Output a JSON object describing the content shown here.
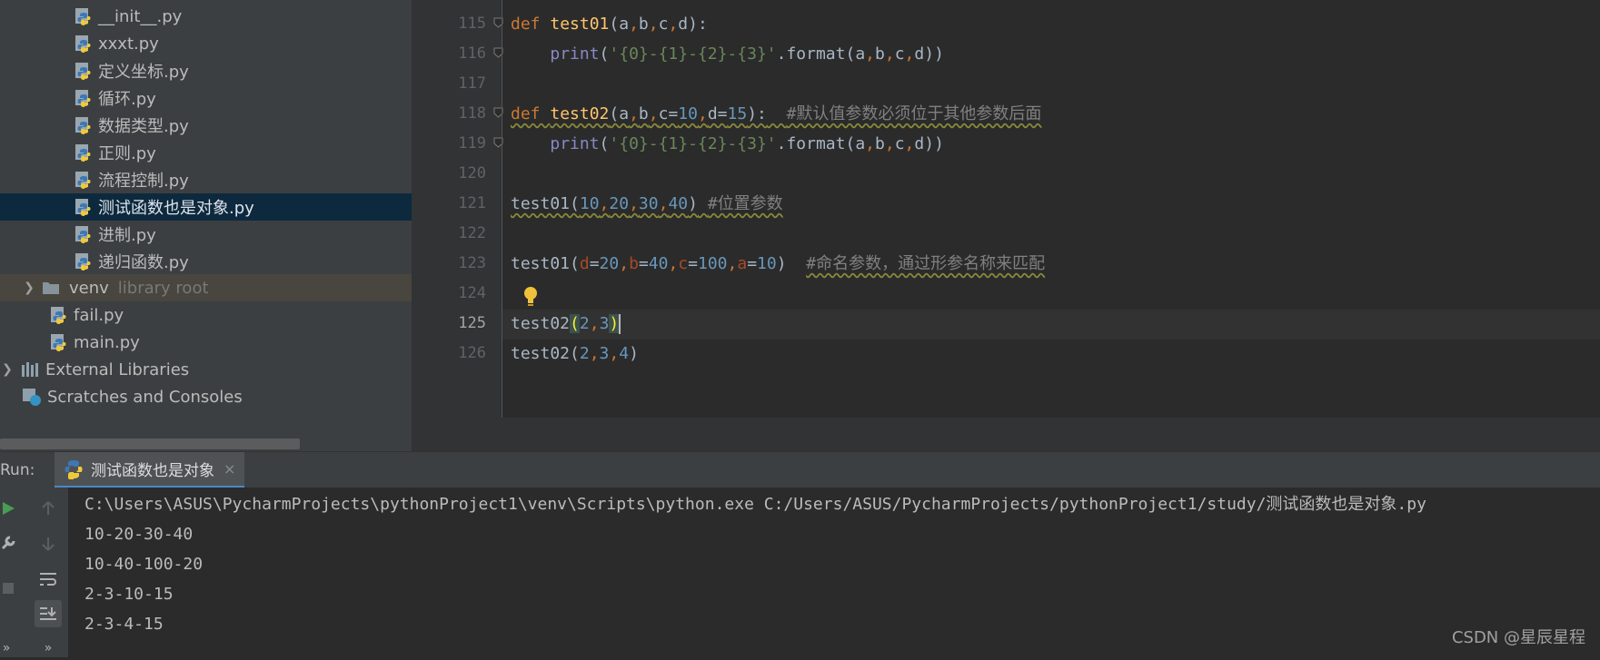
{
  "project_tree": {
    "files": [
      {
        "label": "__init__.py"
      },
      {
        "label": "xxxt.py"
      },
      {
        "label": "定义坐标.py"
      },
      {
        "label": "循环.py"
      },
      {
        "label": "数据类型.py"
      },
      {
        "label": "正则.py"
      },
      {
        "label": "流程控制.py"
      },
      {
        "label": "测试函数也是对象.py",
        "selected": true
      },
      {
        "label": "进制.py"
      },
      {
        "label": "递归函数.py"
      }
    ],
    "venv": {
      "label": "venv",
      "hint": "library root"
    },
    "root_files": [
      {
        "label": "fail.py"
      },
      {
        "label": "main.py"
      }
    ],
    "external_libraries": "External Libraries",
    "scratches": "Scratches and Consoles"
  },
  "editor": {
    "current_line": "125",
    "lines": [
      {
        "num": "115",
        "tokens": [
          {
            "t": "def ",
            "c": "kw"
          },
          {
            "t": "test01",
            "c": "fn"
          },
          {
            "t": "(a",
            "c": ""
          },
          {
            "t": ",",
            "c": "kw"
          },
          {
            "t": "b",
            "c": ""
          },
          {
            "t": ",",
            "c": "kw"
          },
          {
            "t": "c",
            "c": ""
          },
          {
            "t": ",",
            "c": "kw"
          },
          {
            "t": "d):",
            "c": ""
          }
        ]
      },
      {
        "num": "116",
        "tokens": [
          {
            "t": "    ",
            "c": ""
          },
          {
            "t": "print",
            "c": "bi"
          },
          {
            "t": "(",
            "c": ""
          },
          {
            "t": "'{0}-{1}-{2}-{3}'",
            "c": "str"
          },
          {
            "t": ".format(a",
            "c": ""
          },
          {
            "t": ",",
            "c": "kw"
          },
          {
            "t": "b",
            "c": ""
          },
          {
            "t": ",",
            "c": "kw"
          },
          {
            "t": "c",
            "c": ""
          },
          {
            "t": ",",
            "c": "kw"
          },
          {
            "t": "d))",
            "c": ""
          }
        ]
      },
      {
        "num": "117",
        "tokens": []
      },
      {
        "num": "118",
        "tokens": [
          {
            "t": "def ",
            "c": "kw warn"
          },
          {
            "t": "test02",
            "c": "fn warn"
          },
          {
            "t": "(a",
            "c": "warn"
          },
          {
            "t": ",",
            "c": "kw warn"
          },
          {
            "t": "b",
            "c": "warn"
          },
          {
            "t": ",",
            "c": "kw warn"
          },
          {
            "t": "c=",
            "c": "warn"
          },
          {
            "t": "10",
            "c": "num warn"
          },
          {
            "t": ",",
            "c": "kw warn"
          },
          {
            "t": "d=",
            "c": "warn"
          },
          {
            "t": "15",
            "c": "num warn"
          },
          {
            "t": "):",
            "c": "warn"
          },
          {
            "t": "  ",
            "c": "warn"
          },
          {
            "t": "#默认值参数必须位于其他参数后面",
            "c": "cmt warn"
          }
        ]
      },
      {
        "num": "119",
        "tokens": [
          {
            "t": "    ",
            "c": ""
          },
          {
            "t": "print",
            "c": "bi"
          },
          {
            "t": "(",
            "c": ""
          },
          {
            "t": "'{0}-{1}-{2}-{3}'",
            "c": "str"
          },
          {
            "t": ".format(a",
            "c": ""
          },
          {
            "t": ",",
            "c": "kw"
          },
          {
            "t": "b",
            "c": ""
          },
          {
            "t": ",",
            "c": "kw"
          },
          {
            "t": "c",
            "c": ""
          },
          {
            "t": ",",
            "c": "kw"
          },
          {
            "t": "d))",
            "c": ""
          }
        ]
      },
      {
        "num": "120",
        "tokens": []
      },
      {
        "num": "121",
        "tokens": [
          {
            "t": "test01(",
            "c": "warn"
          },
          {
            "t": "10",
            "c": "num warn"
          },
          {
            "t": ",",
            "c": "kw warn"
          },
          {
            "t": "20",
            "c": "num warn"
          },
          {
            "t": ",",
            "c": "kw warn"
          },
          {
            "t": "30",
            "c": "num warn"
          },
          {
            "t": ",",
            "c": "kw warn"
          },
          {
            "t": "40",
            "c": "num warn"
          },
          {
            "t": ")",
            "c": "warn"
          },
          {
            "t": " ",
            "c": "warn"
          },
          {
            "t": "#位置参数",
            "c": "cmt warn"
          }
        ]
      },
      {
        "num": "122",
        "tokens": []
      },
      {
        "num": "123",
        "tokens": [
          {
            "t": "test01(",
            "c": ""
          },
          {
            "t": "d",
            "c": "param"
          },
          {
            "t": "=",
            "c": ""
          },
          {
            "t": "20",
            "c": "num"
          },
          {
            "t": ",",
            "c": "kw"
          },
          {
            "t": "b",
            "c": "param"
          },
          {
            "t": "=",
            "c": ""
          },
          {
            "t": "40",
            "c": "num"
          },
          {
            "t": ",",
            "c": "kw"
          },
          {
            "t": "c",
            "c": "param"
          },
          {
            "t": "=",
            "c": ""
          },
          {
            "t": "100",
            "c": "num"
          },
          {
            "t": ",",
            "c": "kw"
          },
          {
            "t": "a",
            "c": "param"
          },
          {
            "t": "=",
            "c": ""
          },
          {
            "t": "10",
            "c": "num"
          },
          {
            "t": ")  ",
            "c": ""
          },
          {
            "t": "#命名参数，通过形参名称来匹配",
            "c": "cmt warn"
          }
        ]
      },
      {
        "num": "124",
        "tokens": []
      },
      {
        "num": "125",
        "tokens": [
          {
            "t": "test02",
            "c": ""
          },
          {
            "t": "(",
            "c": "paren-hl"
          },
          {
            "t": "2",
            "c": "num"
          },
          {
            "t": ",",
            "c": "kw"
          },
          {
            "t": "3",
            "c": "num"
          },
          {
            "t": ")",
            "c": "paren-hl"
          }
        ],
        "caret": true
      },
      {
        "num": "126",
        "tokens": [
          {
            "t": "test02(",
            "c": ""
          },
          {
            "t": "2",
            "c": "num"
          },
          {
            "t": ",",
            "c": "kw"
          },
          {
            "t": "3",
            "c": "num"
          },
          {
            "t": ",",
            "c": "kw"
          },
          {
            "t": "4",
            "c": "num"
          },
          {
            "t": ")",
            "c": ""
          }
        ]
      }
    ]
  },
  "run_panel": {
    "label": "Run:",
    "tab_label": "测试函数也是对象",
    "tab_close": "×",
    "console_lines": [
      "C:\\Users\\ASUS\\PycharmProjects\\pythonProject1\\venv\\Scripts\\python.exe C:/Users/ASUS/PycharmProjects/pythonProject1/study/测试函数也是对象.py",
      "10-20-30-40",
      "10-40-100-20",
      "2-3-10-15",
      "2-3-4-15"
    ],
    "toolbar_icons": [
      "run-icon",
      "wrench-icon",
      "stop-icon",
      "up-arrow-icon",
      "down-arrow-icon",
      "soft-wrap-icon",
      "scroll-to-end-icon",
      "expand-icon"
    ]
  },
  "watermark": "CSDN @星辰星程",
  "colors": {
    "tree_bg": "#3c3f41",
    "editor_bg": "#2b2b2b",
    "selection": "#0d293e",
    "keyword": "#cc7832",
    "function": "#ffc66d",
    "number": "#6897bb",
    "string": "#6a8759",
    "comment": "#808080",
    "run_green": "#499c54"
  }
}
